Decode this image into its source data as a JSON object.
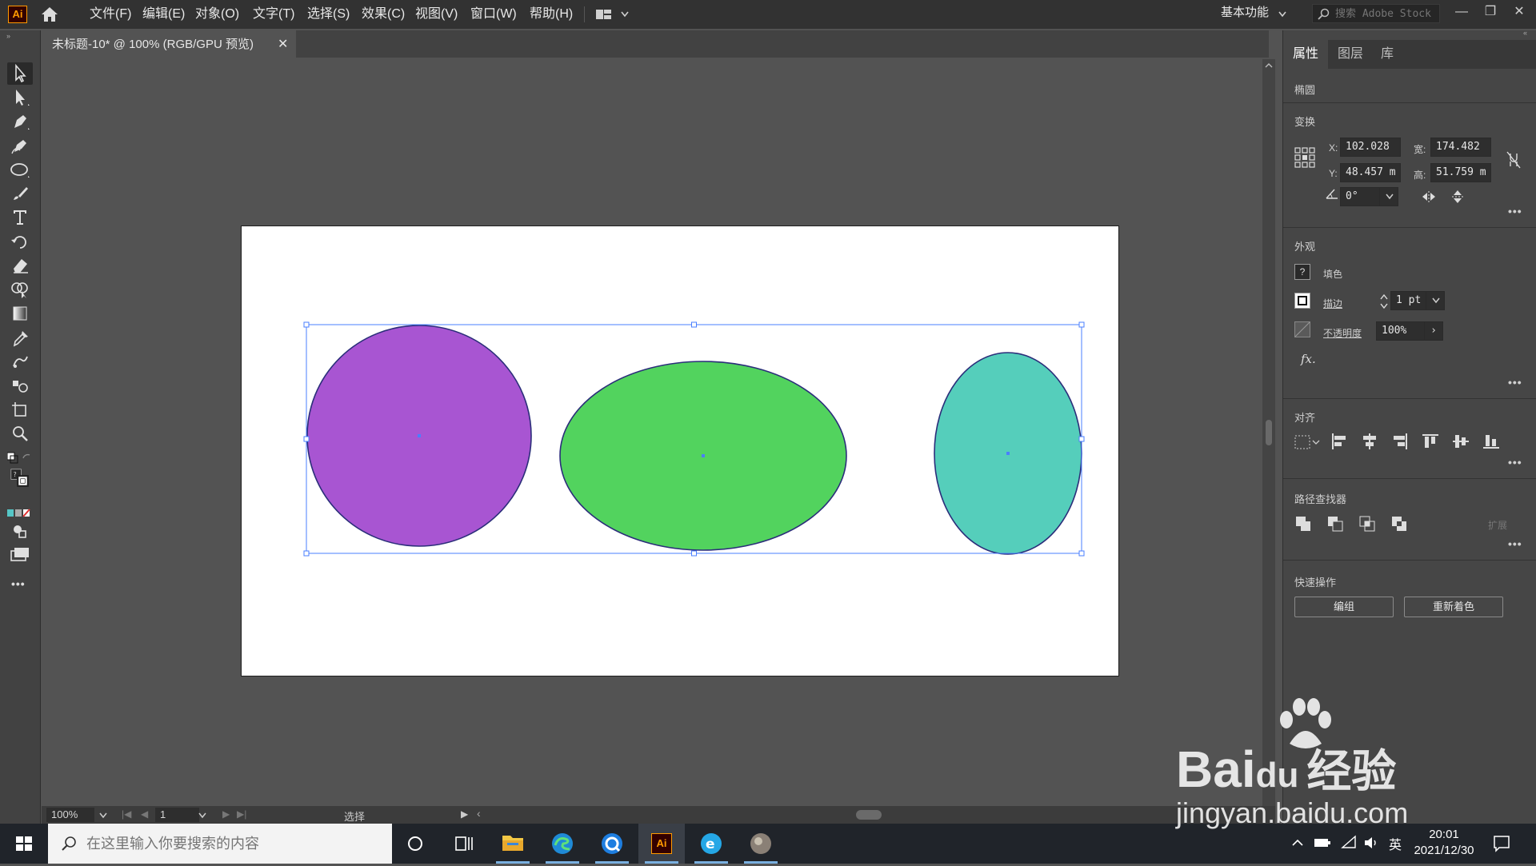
{
  "app": {
    "logo_text": "Ai",
    "menus": [
      "文件(F)",
      "编辑(E)",
      "对象(O)",
      "文字(T)",
      "选择(S)",
      "效果(C)",
      "视图(V)",
      "窗口(W)",
      "帮助(H)"
    ],
    "workspace_label": "基本功能",
    "stock_search_placeholder": "搜索 Adobe Stock",
    "window_buttons": [
      "—",
      "❐",
      "✕"
    ]
  },
  "document": {
    "tab_title": "未标题-10* @ 100% (RGB/GPU 预览)",
    "tab_close": "✕"
  },
  "artwork": {
    "shapes": [
      {
        "name": "purple-circle",
        "fill": "#a855d2"
      },
      {
        "name": "green-ellipse",
        "fill": "#52d35e"
      },
      {
        "name": "teal-ellipse",
        "fill": "#55cebb"
      }
    ],
    "stroke_color": "#2b2e7a",
    "selection_color": "#4a7fff"
  },
  "statusbar": {
    "zoom": "100%",
    "artboard_number": "1",
    "tool_name": "选择"
  },
  "panel": {
    "tabs": [
      "属性",
      "图层",
      "库"
    ],
    "object_type": "椭圆",
    "transform": {
      "title": "变换",
      "x_label": "X:",
      "x_value": "102.028",
      "y_label": "Y:",
      "y_value": "48.457 m",
      "w_label": "宽:",
      "w_value": "174.482",
      "h_label": "高:",
      "h_value": "51.759 m",
      "angle_value": "0°"
    },
    "appearance": {
      "title": "外观",
      "fill_label": "填色",
      "stroke_label": "描边",
      "stroke_value": "1 pt",
      "opacity_label": "不透明度",
      "opacity_value": "100%",
      "fx_label": "fx."
    },
    "align": {
      "title": "对齐"
    },
    "pathfinder": {
      "title": "路径查找器",
      "expand_label": "扩展"
    },
    "quick_actions": {
      "title": "快速操作",
      "group_label": "编组",
      "recolor_label": "重新着色"
    },
    "more": "•••"
  },
  "taskbar": {
    "search_placeholder": "在这里输入你要搜索的内容",
    "ai_label": "Ai",
    "ime": "英",
    "time": "20:01",
    "date": "2021/12/30"
  },
  "watermark": {
    "brand": "Bai",
    "brand2": "du",
    "cn": "经验",
    "url": "jingyan.baidu.com"
  }
}
